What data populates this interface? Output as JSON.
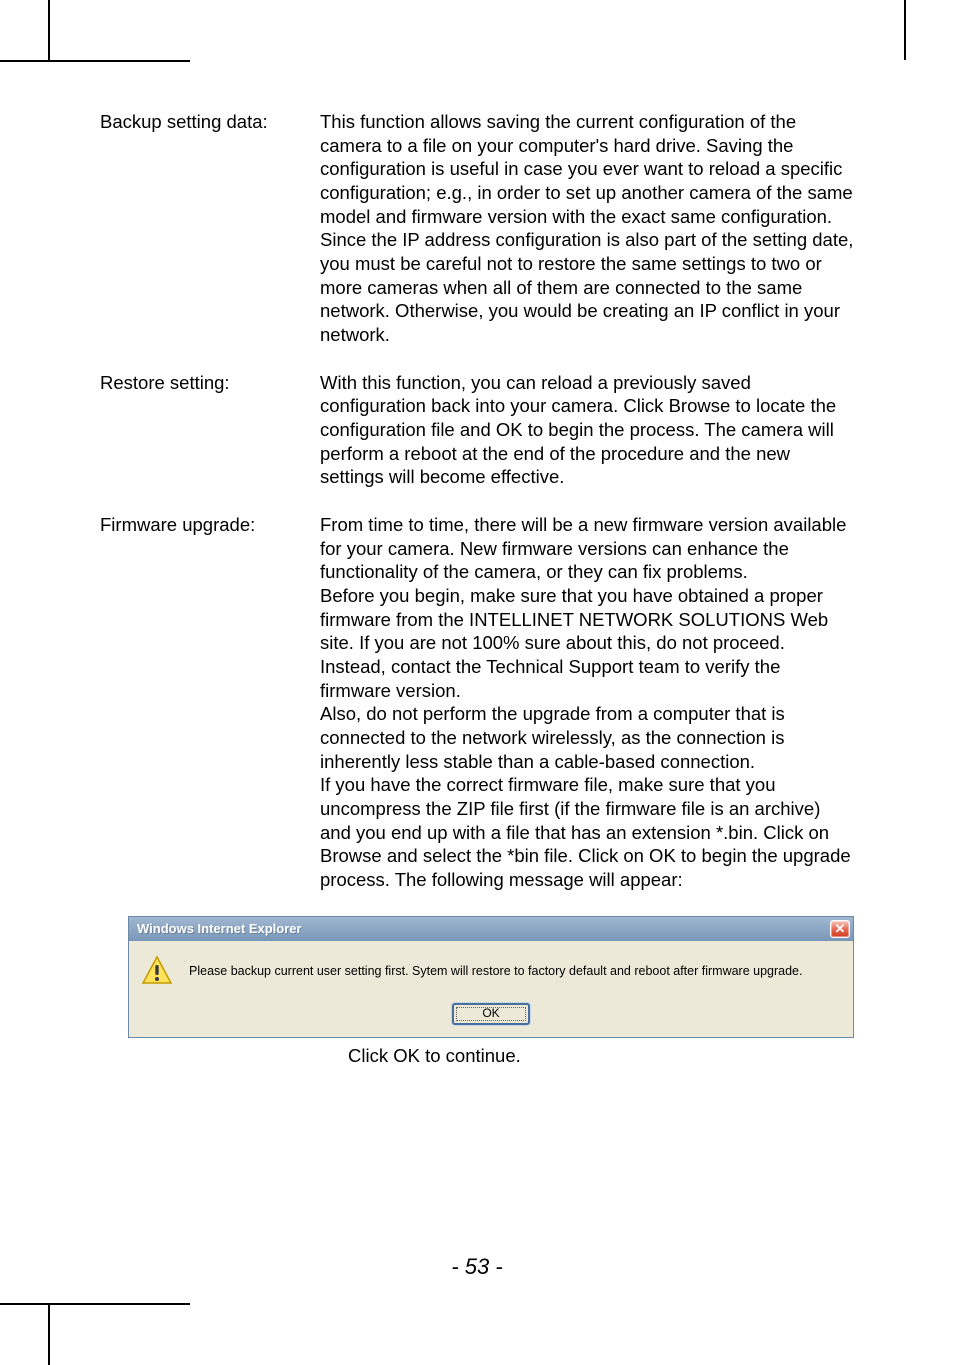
{
  "sections": [
    {
      "label": "Backup setting data:",
      "paragraphs": [
        "This function allows saving the current configuration of the camera to a file on your computer's hard drive. Saving the configuration is useful in case you ever want to reload a specific configuration; e.g., in order to set up another camera of the same model and firmware version with the exact same configuration. Since the IP address configuration is also part of the setting date, you must be careful not to restore the same settings to two or more cameras when all of them are connected to the same network. Otherwise, you would be creating an IP conflict in your network."
      ]
    },
    {
      "label": "Restore setting:",
      "paragraphs": [
        "With this function, you can reload a previously saved configuration back into your camera. Click Browse to locate the configuration file and OK to begin the process. The camera will perform a reboot at the end of the procedure and the new settings will become effective."
      ]
    },
    {
      "label": "Firmware upgrade:",
      "paragraphs": [
        "From time to time, there will be a new firmware version available for your camera. New firmware versions can enhance the functionality of the camera, or they can fix problems.",
        "Before you begin, make sure that you have obtained a proper firmware from the INTELLINET NETWORK SOLUTIONS Web site. If you are not 100% sure about this, do not proceed. Instead, contact the Technical Support team to verify the firmware version.",
        "Also, do not perform the upgrade from a computer that is connected to the network wirelessly, as the connection is inherently less stable than a cable-based connection.",
        "If you have the correct firmware file, make sure that you uncompress the ZIP file first (if the firmware file is an archive) and you end up with a file that has an extension *.bin. Click on Browse and select the *bin file. Click on OK to begin the upgrade process. The following message will appear:"
      ]
    }
  ],
  "dialog": {
    "title": "Windows Internet Explorer",
    "close_glyph": "✕",
    "message": "Please backup current user setting first. Sytem will restore to factory default and reboot after firmware upgrade.",
    "ok_label": "OK"
  },
  "after_dialog": "Click OK to continue.",
  "page_number": "- 53 -"
}
